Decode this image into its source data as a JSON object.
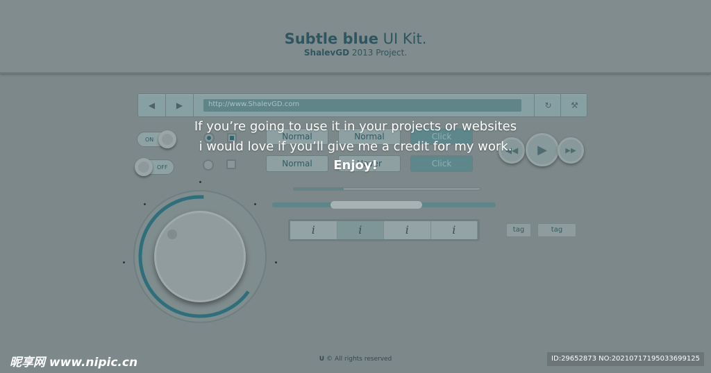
{
  "header": {
    "title_bold": "Subtle blue",
    "title_rest": " UI Kit.",
    "subtitle_bold": "ShalevGD",
    "subtitle_rest": " 2013 Project."
  },
  "browser": {
    "back_icon": "◀",
    "forward_icon": "▶",
    "url": "http://www.ShalevGD.com",
    "refresh_icon": "↻",
    "settings_icon": "wrench"
  },
  "toggles": {
    "on": "ON",
    "off": "OFF"
  },
  "buttons": {
    "row1": [
      "Normal",
      "Normal",
      "Click"
    ],
    "row2": [
      "Normal",
      "Hover",
      "Click"
    ]
  },
  "segmented": {
    "items": [
      "i",
      "i",
      "i",
      "i"
    ],
    "active_index": 1
  },
  "tags": [
    "tag",
    "tag"
  ],
  "sliders": {
    "top_value": 0.27,
    "range": [
      0.26,
      0.67
    ]
  },
  "dial": {
    "value": 0.6
  },
  "overlay": {
    "line1": "If you’re going to use it in your projects or websites",
    "line2": "i would love if you’ll give me a credit for my work.",
    "line3": "Enjoy!"
  },
  "footer": {
    "text": "© All rights reserved"
  },
  "watermark": {
    "site": "昵享网 www.nipic.cn",
    "id": "ID:29652873 NO:20210717195033699125"
  },
  "colors": {
    "accent": "#2f5a64",
    "background": "#7c8889"
  }
}
